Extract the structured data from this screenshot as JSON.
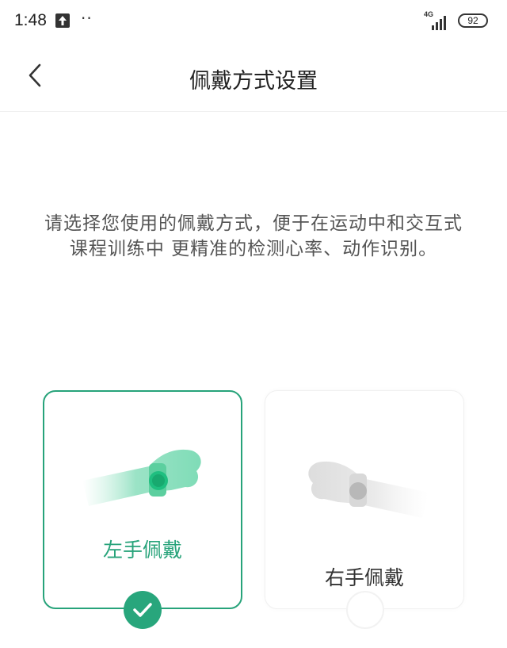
{
  "status_bar": {
    "time": "1:48",
    "upload_icon": "upload-arrow-icon",
    "notification_dots": "··",
    "network_type": "4G",
    "battery_level": "92"
  },
  "nav": {
    "back_icon": "chevron-left-icon",
    "title": "佩戴方式设置"
  },
  "description": "请选择您使用的佩戴方式，便于在运动中和交互式课程训练中 更精准的检测心率、动作识别。",
  "options": [
    {
      "label": "左手佩戴",
      "selected": true
    },
    {
      "label": "右手佩戴",
      "selected": false
    }
  ],
  "colors": {
    "accent": "#27a37a",
    "check_bg": "#28a67c",
    "text_primary": "#222222",
    "text_secondary": "#555555"
  }
}
